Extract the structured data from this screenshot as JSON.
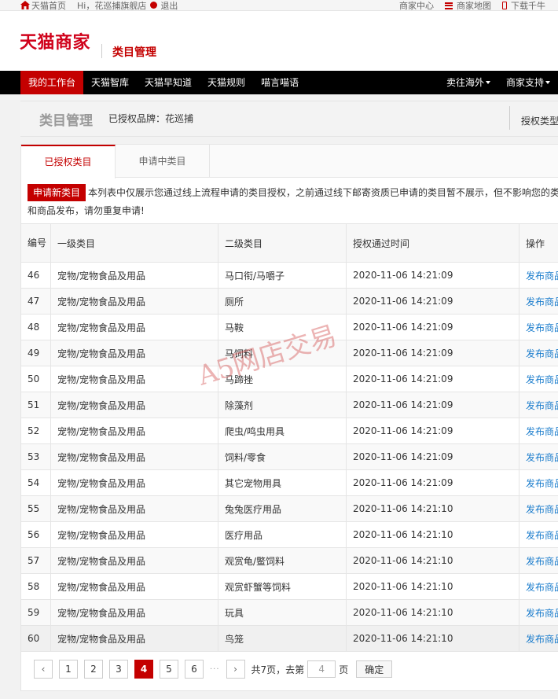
{
  "topbar": {
    "home": "天猫首页",
    "greeting": "Hi，花巡捕旗舰店",
    "logout": "退出",
    "merchant_center": "商家中心",
    "merchant_map": "商家地图",
    "download": "下载千牛"
  },
  "header": {
    "logo": "天猫商家",
    "title": "类目管理"
  },
  "nav": {
    "items": [
      "我的工作台",
      "天猫智库",
      "天猫早知道",
      "天猫规则",
      "喵言喵语"
    ],
    "right": [
      "卖往海外",
      "商家支持"
    ]
  },
  "heading": {
    "title": "类目管理",
    "brand": "已授权品牌：花巡捕",
    "right": "授权类型"
  },
  "tabs": {
    "active": "已授权类目",
    "inactive": "申请中类目"
  },
  "notice": {
    "button": "申请新类目",
    "line1": "本列表中仅展示您通过线上流程申请的类目授权，之前通过线下邮寄资质已申请的类目暂不展示，但不影响您的类",
    "line2": "和商品发布，请勿重复申请!"
  },
  "table": {
    "headers": [
      "编号",
      "一级类目",
      "二级类目",
      "授权通过时间",
      "操作"
    ],
    "rows": [
      {
        "id": "46",
        "cat1": "宠物/宠物食品及用品",
        "cat2": "马口衔/马嚼子",
        "time": "2020-11-06 14:21:09",
        "op": "发布商品"
      },
      {
        "id": "47",
        "cat1": "宠物/宠物食品及用品",
        "cat2": "厕所",
        "time": "2020-11-06 14:21:09",
        "op": "发布商品"
      },
      {
        "id": "48",
        "cat1": "宠物/宠物食品及用品",
        "cat2": "马鞍",
        "time": "2020-11-06 14:21:09",
        "op": "发布商品"
      },
      {
        "id": "49",
        "cat1": "宠物/宠物食品及用品",
        "cat2": "马饲料",
        "time": "2020-11-06 14:21:09",
        "op": "发布商品"
      },
      {
        "id": "50",
        "cat1": "宠物/宠物食品及用品",
        "cat2": "马蹄挫",
        "time": "2020-11-06 14:21:09",
        "op": "发布商品"
      },
      {
        "id": "51",
        "cat1": "宠物/宠物食品及用品",
        "cat2": "除藻剂",
        "time": "2020-11-06 14:21:09",
        "op": "发布商品"
      },
      {
        "id": "52",
        "cat1": "宠物/宠物食品及用品",
        "cat2": "爬虫/鸣虫用具",
        "time": "2020-11-06 14:21:09",
        "op": "发布商品"
      },
      {
        "id": "53",
        "cat1": "宠物/宠物食品及用品",
        "cat2": "饲料/零食",
        "time": "2020-11-06 14:21:09",
        "op": "发布商品"
      },
      {
        "id": "54",
        "cat1": "宠物/宠物食品及用品",
        "cat2": "其它宠物用具",
        "time": "2020-11-06 14:21:09",
        "op": "发布商品"
      },
      {
        "id": "55",
        "cat1": "宠物/宠物食品及用品",
        "cat2": "兔兔医疗用品",
        "time": "2020-11-06 14:21:10",
        "op": "发布商品"
      },
      {
        "id": "56",
        "cat1": "宠物/宠物食品及用品",
        "cat2": "医疗用品",
        "time": "2020-11-06 14:21:10",
        "op": "发布商品"
      },
      {
        "id": "57",
        "cat1": "宠物/宠物食品及用品",
        "cat2": "观赏龟/鳖饲料",
        "time": "2020-11-06 14:21:10",
        "op": "发布商品"
      },
      {
        "id": "58",
        "cat1": "宠物/宠物食品及用品",
        "cat2": "观赏虾蟹等饲料",
        "time": "2020-11-06 14:21:10",
        "op": "发布商品"
      },
      {
        "id": "59",
        "cat1": "宠物/宠物食品及用品",
        "cat2": "玩具",
        "time": "2020-11-06 14:21:10",
        "op": "发布商品"
      },
      {
        "id": "60",
        "cat1": "宠物/宠物食品及用品",
        "cat2": "鸟笼",
        "time": "2020-11-06 14:21:10",
        "op": "发布商品"
      }
    ]
  },
  "pager": {
    "prev": "‹",
    "pages": [
      "1",
      "2",
      "3",
      "4",
      "5",
      "6"
    ],
    "current": "4",
    "ellipsis": "···",
    "next": "›",
    "total_text": "共7页，去第",
    "input_value": "4",
    "page_unit": "页",
    "confirm": "确定"
  },
  "watermark": "A5网店交易",
  "colors": {
    "brand": "#c40000",
    "link": "#1a7ccc"
  }
}
